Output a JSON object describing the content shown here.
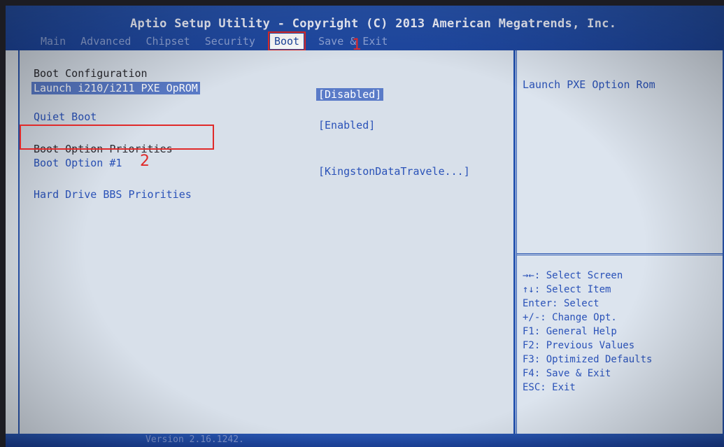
{
  "app_title": "Aptio Setup Utility - Copyright (C) 2013 American Megatrends, Inc.",
  "menu": [
    {
      "label": "Main"
    },
    {
      "label": "Advanced"
    },
    {
      "label": "Chipset"
    },
    {
      "label": "Security"
    },
    {
      "label": "Boot"
    },
    {
      "label": "Save & Exit"
    }
  ],
  "annotations": {
    "step1": "1",
    "step2": "2"
  },
  "boot": {
    "section_config": "Boot Configuration",
    "launch_pxe_label": "Launch i210/i211 PXE OpROM",
    "launch_pxe_value": "[Disabled]",
    "quiet_boot_label": "Quiet Boot",
    "quiet_boot_value": "[Enabled]",
    "section_priorities": "Boot Option Priorities",
    "boot_option1_label": "Boot Option #1",
    "boot_option1_value": "[KingstonDataTravele...]",
    "hdd_bbs_label": "Hard Drive BBS Priorities"
  },
  "help": {
    "description": "Launch PXE Option Rom",
    "keys": [
      "→←: Select Screen",
      "↑↓: Select Item",
      "Enter: Select",
      "+/-: Change Opt.",
      "F1: General Help",
      "F2: Previous Values",
      "F3: Optimized Defaults",
      "F4: Save & Exit",
      "ESC: Exit"
    ]
  },
  "footer": {
    "version": "Version 2.16.1242."
  },
  "colors": {
    "title_bg": "#2855b0",
    "panel_bg": "#d8e0ea",
    "accent_text": "#2a52b8",
    "annotation": "#e02a2a"
  }
}
